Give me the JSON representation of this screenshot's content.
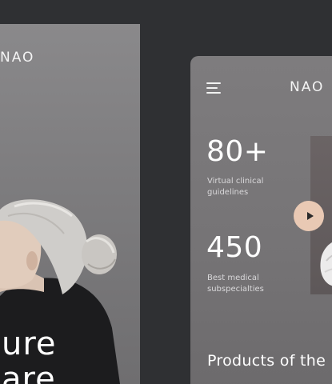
{
  "left_screen": {
    "brand": "NAO",
    "hero_line_1": "ure",
    "hero_line_2": "are"
  },
  "right_screen": {
    "menu_icon": "hamburger-menu-icon",
    "brand": "NAO",
    "stats": [
      {
        "value": "80+",
        "label": "Virtual clinical guidelines"
      },
      {
        "value": "450",
        "label": "Best medical subspecialties"
      }
    ],
    "play_icon": "play-icon",
    "section_title": "Products of the"
  },
  "colors": {
    "background": "#2f3033",
    "card": "#7e7c7e",
    "accent": "#e9c9b4",
    "text": "#ffffff"
  }
}
